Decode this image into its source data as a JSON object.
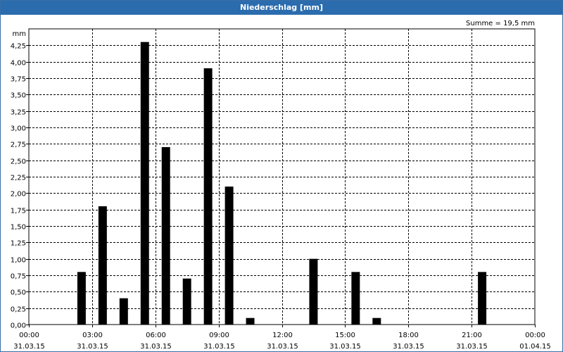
{
  "chart_data": {
    "type": "bar",
    "title": "Niederschlag [mm]",
    "ylabel": "mm",
    "sum_label": "Summe = 19,5 mm",
    "ylim": [
      0,
      4.5
    ],
    "yticks": [
      "0,00",
      "0,25",
      "0,50",
      "0,75",
      "1,00",
      "1,25",
      "1,50",
      "1,75",
      "2,00",
      "2,25",
      "2,50",
      "2,75",
      "3,00",
      "3,25",
      "3,50",
      "3,75",
      "4,00",
      "4,25"
    ],
    "xticks": [
      {
        "time": "00:00",
        "date": "31.03.15"
      },
      {
        "time": "03:00",
        "date": "31.03.15"
      },
      {
        "time": "06:00",
        "date": "31.03.15"
      },
      {
        "time": "09:00",
        "date": "31.03.15"
      },
      {
        "time": "12:00",
        "date": "31.03.15"
      },
      {
        "time": "15:00",
        "date": "31.03.15"
      },
      {
        "time": "18:00",
        "date": "31.03.15"
      },
      {
        "time": "21:00",
        "date": "31.03.15"
      },
      {
        "time": "00:00",
        "date": "01.04.15"
      }
    ],
    "x_unit": "hour",
    "xlim": [
      0,
      24
    ],
    "bars": [
      {
        "hour": 3,
        "value": 0.8
      },
      {
        "hour": 4,
        "value": 1.8
      },
      {
        "hour": 5,
        "value": 0.4
      },
      {
        "hour": 6,
        "value": 4.3
      },
      {
        "hour": 7,
        "value": 2.7
      },
      {
        "hour": 8,
        "value": 0.7
      },
      {
        "hour": 9,
        "value": 3.9
      },
      {
        "hour": 10,
        "value": 2.1
      },
      {
        "hour": 11,
        "value": 0.1
      },
      {
        "hour": 14,
        "value": 1.0
      },
      {
        "hour": 16,
        "value": 0.8
      },
      {
        "hour": 17,
        "value": 0.1
      },
      {
        "hour": 22,
        "value": 0.8
      }
    ],
    "grid": true,
    "colors": {
      "bar": "#000000",
      "titlebar": "#2b6cae",
      "grid": "#000000"
    }
  }
}
